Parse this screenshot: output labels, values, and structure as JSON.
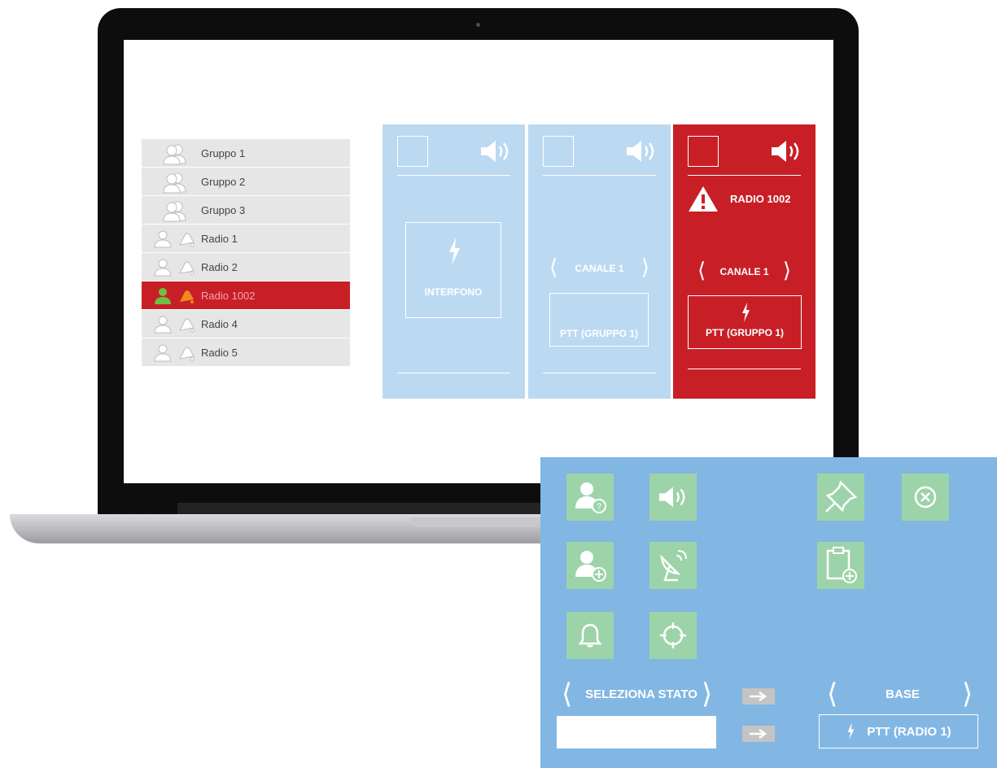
{
  "list": {
    "items": [
      {
        "label": "Gruppo 1",
        "kind": "group",
        "active": false
      },
      {
        "label": "Gruppo 2",
        "kind": "group",
        "active": false
      },
      {
        "label": "Gruppo 3",
        "kind": "group",
        "active": false
      },
      {
        "label": "Radio 1",
        "kind": "radio",
        "active": false
      },
      {
        "label": "Radio 2",
        "kind": "radio",
        "active": false
      },
      {
        "label": "Radio 1002",
        "kind": "radio",
        "active": true
      },
      {
        "label": "Radio 4",
        "kind": "radio",
        "active": false
      },
      {
        "label": "Radio 5",
        "kind": "radio",
        "active": false
      }
    ]
  },
  "panels": {
    "p1": {
      "intercom_label": "INTERFONO"
    },
    "p2": {
      "channel_label": "CANALE 1",
      "ptt_label": "PTT (GRUPPO 1)"
    },
    "p3": {
      "alert_label": "RADIO 1002",
      "channel_label": "CANALE 1",
      "ptt_label": "PTT (GRUPPO 1)"
    }
  },
  "overlay": {
    "icons": [
      "user-question-icon",
      "speaker-icon",
      "pin-icon",
      "close-circle-icon",
      "user-add-icon",
      "satellite-dish-icon",
      "clipboard-add-icon",
      "bell-icon",
      "crosshair-icon"
    ],
    "state_label": "SELEZIONA STATO",
    "base_label": "BASE",
    "ptt_radio_label": "PTT (RADIO 1)",
    "state_input_value": ""
  },
  "colors": {
    "alert_red": "#c81f26",
    "panel_blue": "#bcd9f2",
    "overlay_blue": "#82b7e3",
    "tile_green": "#9dd3a9",
    "active_user_green": "#6fbf44",
    "active_bell_orange": "#f08a1e"
  }
}
